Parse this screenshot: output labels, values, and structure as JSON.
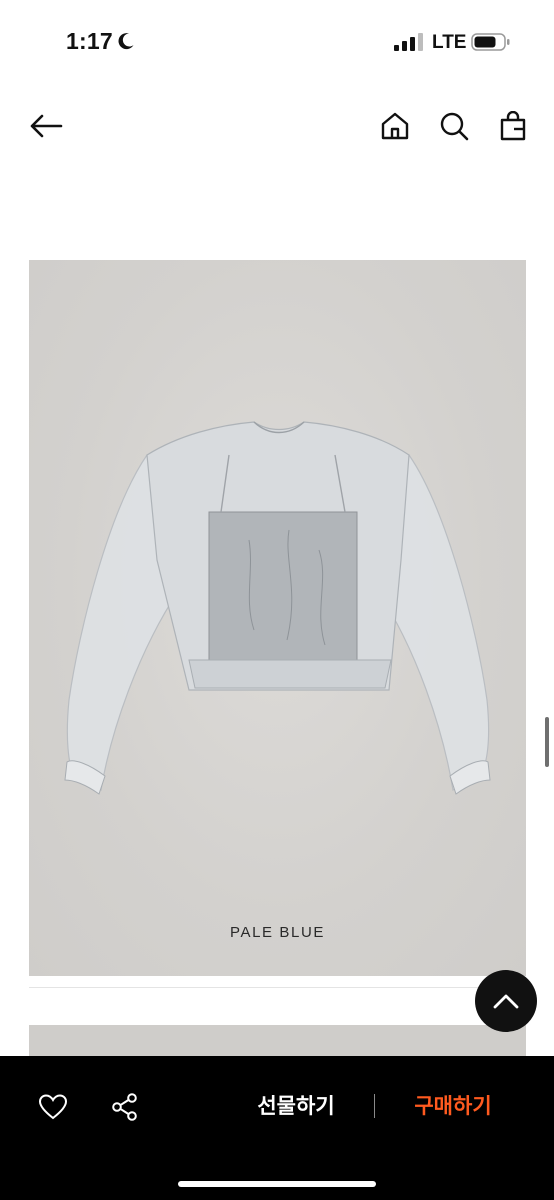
{
  "status_bar": {
    "time": "1:17",
    "moon_icon": "moon-icon",
    "signal_icon": "cellular-signal-icon",
    "carrier": "LTE",
    "battery_icon": "battery-icon"
  },
  "nav": {
    "back_icon": "arrow-left-icon",
    "home_icon": "home-icon",
    "search_icon": "search-icon",
    "bag_icon": "shopping-bag-icon"
  },
  "product_image": {
    "color_label": "PALE BLUE",
    "background_color": "#d6d4d1"
  },
  "scroll_top_icon": "chevron-up-icon",
  "bottom_bar": {
    "like_icon": "heart-icon",
    "share_icon": "share-icon",
    "gift_label": "선물하기",
    "buy_label": "구매하기",
    "buy_color": "#ff5a1f",
    "background_color": "#000000"
  }
}
